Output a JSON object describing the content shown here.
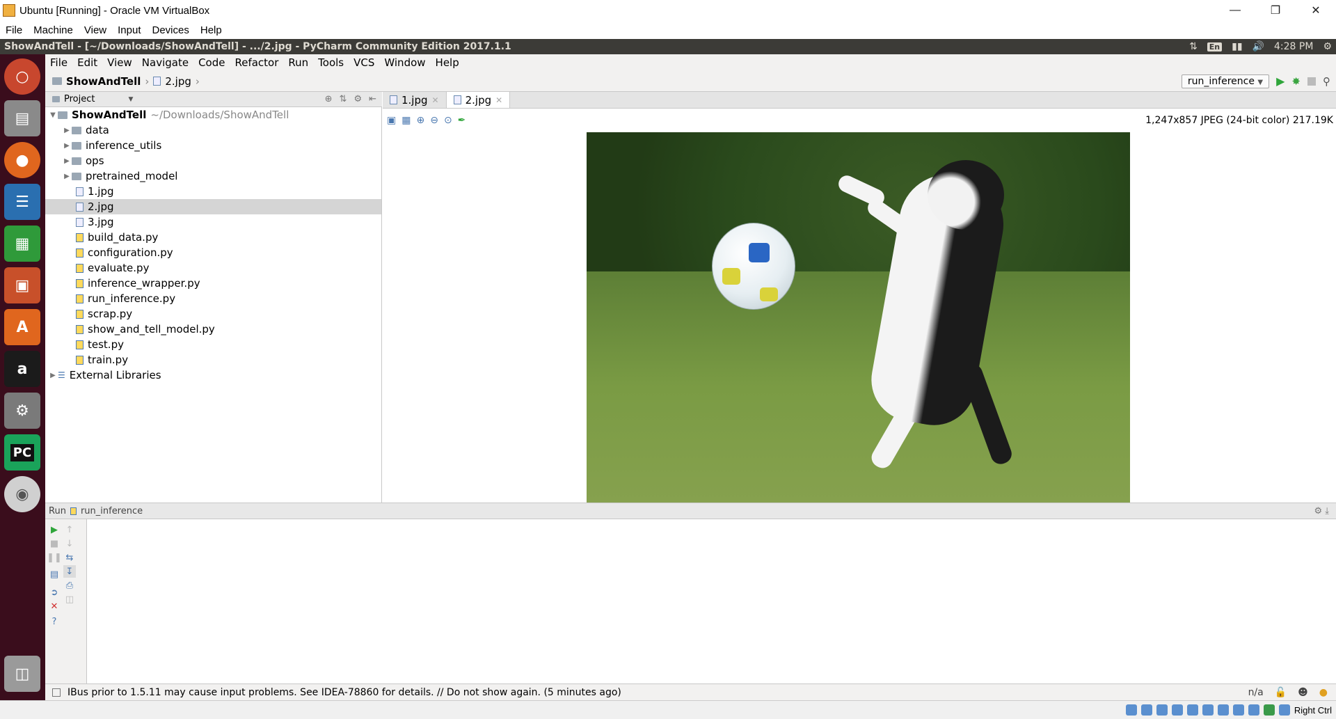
{
  "vbox": {
    "title": "Ubuntu [Running] - Oracle VM VirtualBox",
    "menu": [
      "File",
      "Machine",
      "View",
      "Input",
      "Devices",
      "Help"
    ],
    "host_key": "Right Ctrl"
  },
  "ubuntu_panel": {
    "window_title": "ShowAndTell - [~/Downloads/ShowAndTell] - .../2.jpg - PyCharm Community Edition 2017.1.1",
    "keyboard": "En",
    "clock": "4:28 PM"
  },
  "pycharm": {
    "menu": [
      "File",
      "Edit",
      "View",
      "Navigate",
      "Code",
      "Refactor",
      "Run",
      "Tools",
      "VCS",
      "Window",
      "Help"
    ],
    "breadcrumb": [
      "ShowAndTell",
      "2.jpg"
    ],
    "run_config": "run_inference",
    "project": {
      "header": "Project",
      "root": "ShowAndTell",
      "root_path": "~/Downloads/ShowAndTell",
      "folders": [
        "data",
        "inference_utils",
        "ops",
        "pretrained_model"
      ],
      "files": [
        "1.jpg",
        "2.jpg",
        "3.jpg",
        "build_data.py",
        "configuration.py",
        "evaluate.py",
        "inference_wrapper.py",
        "run_inference.py",
        "scrap.py",
        "show_and_tell_model.py",
        "test.py",
        "train.py"
      ],
      "selected": "2.jpg",
      "external": "External Libraries"
    },
    "tabs": [
      "1.jpg",
      "2.jpg"
    ],
    "active_tab": "2.jpg",
    "image_info": "1,247x857 JPEG (24-bit color) 217.19K",
    "run_panel": {
      "label": "Run",
      "config": "run_inference"
    },
    "status": {
      "message": "IBus prior to 1.5.11 may cause input problems. See IDEA-78860 for details. // Do not show again. (5 minutes ago)",
      "position": "n/a"
    }
  }
}
